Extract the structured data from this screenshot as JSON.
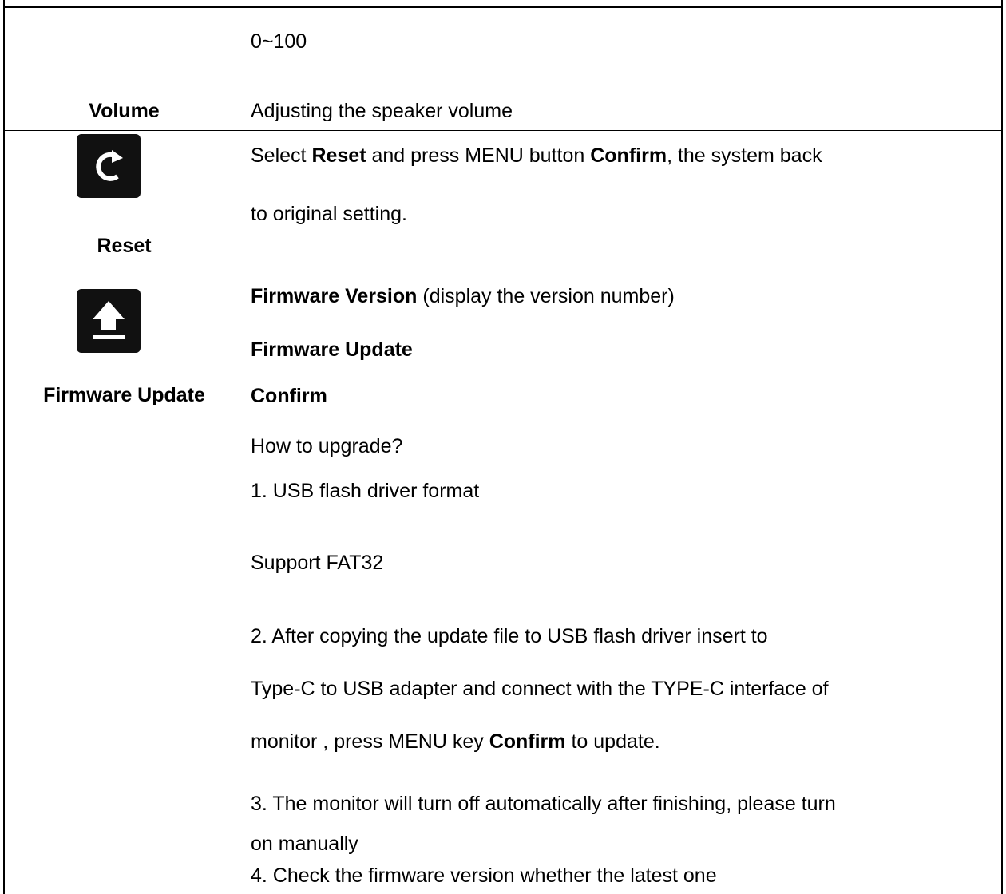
{
  "volume": {
    "label": "Volume",
    "range": "0~100",
    "description": "Adjusting the speaker volume"
  },
  "reset": {
    "icon": "refresh-icon",
    "label": "Reset",
    "line1_pre": "Select ",
    "line1_b1": "Reset",
    "line1_mid": " and press MENU button ",
    "line1_b2": "Confirm",
    "line1_post": ", the system back",
    "line2": "to original setting."
  },
  "firmware": {
    "icon": "upload-icon",
    "label": "Firmware Update",
    "version_b": "Firmware Version",
    "version_rest": " (display the version number)",
    "update_b": "Firmware Update",
    "confirm_b": "Confirm",
    "how": "How to upgrade?",
    "step1": "1. USB flash driver format",
    "support": "Support FAT32",
    "step2_l1": "2. After copying the update file to USB flash driver insert to",
    "step2_l2": "Type-C to USB adapter and connect with the TYPE-C interface of",
    "step2_l3_pre": "monitor , press MENU key ",
    "step2_l3_b": "Confirm",
    "step2_l3_post": " to update.",
    "step3_l1": "3. The monitor will turn off automatically after finishing, please turn",
    "step3_l2": "on manually",
    "step4": "4. Check the firmware version whether the latest one"
  }
}
